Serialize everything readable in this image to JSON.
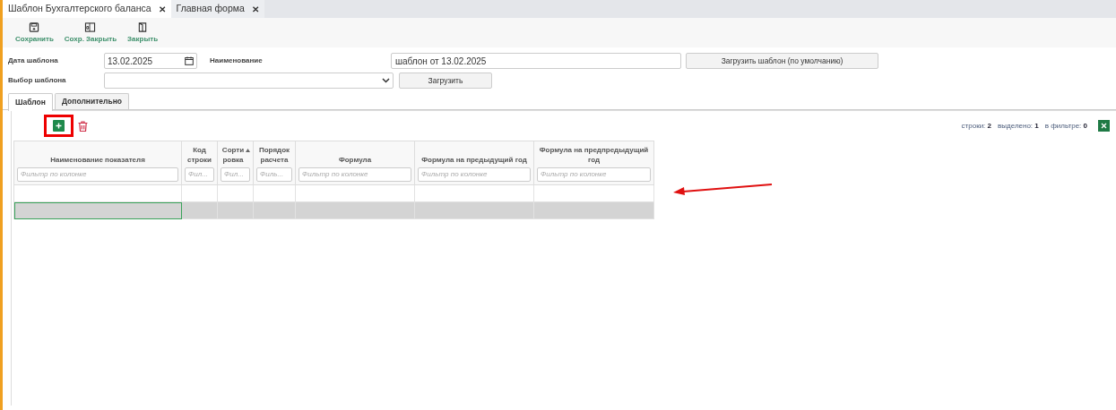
{
  "doc_tabs": [
    {
      "label": "Шаблон Бухгалтерского баланса",
      "close": "✕",
      "selected": true
    },
    {
      "label": "Главная форма",
      "close": "✕",
      "selected": false
    }
  ],
  "toolbar": [
    {
      "kind": "save",
      "label": "Сохранить"
    },
    {
      "kind": "save_close",
      "label": "Сохр. Закрыть"
    },
    {
      "kind": "close",
      "label": "Закрыть"
    }
  ],
  "form": {
    "date_label": "Дата шаблона",
    "date_value": "13.02.2025",
    "name_label": "Наименование",
    "name_value": "шаблон от 13.02.2025",
    "load_default_button": "Загрузить шаблон (по умолчанию)",
    "choose_label": "Выбор шаблона",
    "load_button": "Загрузить"
  },
  "tabs": [
    {
      "label": "Шаблон",
      "selected": true
    },
    {
      "label": "Дополнительно",
      "selected": false
    }
  ],
  "stats": [
    {
      "label": "строки:",
      "value": "2"
    },
    {
      "label": "выделено:",
      "value": "1"
    },
    {
      "label": "в фильтре:",
      "value": "0"
    }
  ],
  "table": {
    "columns": [
      {
        "title": "Наименование показателя",
        "filter": "Фильтр по колонке",
        "sorted": false
      },
      {
        "title": "Код строки",
        "filter": "Фил...",
        "sorted": false
      },
      {
        "title": "Сортировка",
        "filter": "Фил...",
        "sorted": true
      },
      {
        "title": "Порядок расчета",
        "filter": "Филь...",
        "sorted": false
      },
      {
        "title": "Формула",
        "filter": "Фильтр по колонке",
        "sorted": false
      },
      {
        "title": "Формула на предыдущий год",
        "filter": "Фильтр по колонке",
        "sorted": false
      },
      {
        "title": "Формула на предпредыдущий год",
        "filter": "Фильтр по колонке",
        "sorted": false
      }
    ],
    "rows": [
      {
        "selected": false
      },
      {
        "selected": true
      }
    ]
  }
}
